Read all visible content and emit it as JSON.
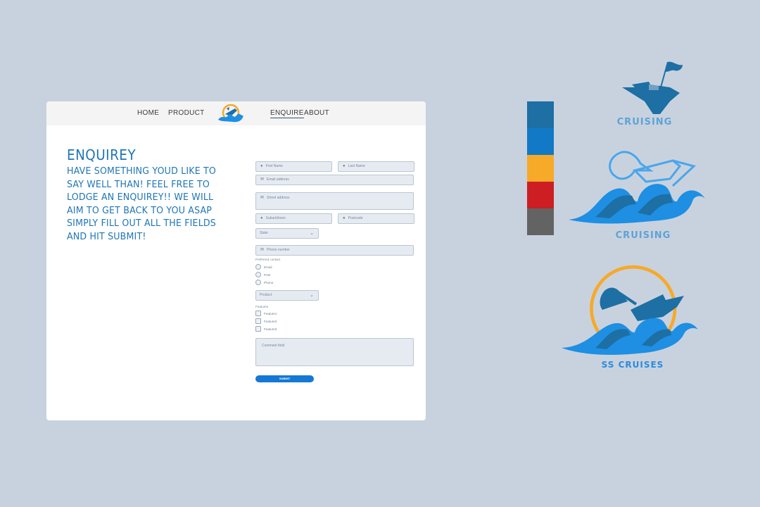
{
  "nav": {
    "home": "HOME",
    "product": "PRODUCT",
    "enquire": "ENQUIRE",
    "about": "ABOUT"
  },
  "hero": {
    "title": "ENQUIREY",
    "text": "HAVE SOMETHING YOUD LIKE TO SAY WELL THAN! FEEL FREE TO LODGE AN ENQUIREY!! WE WILL AIM TO GET BACK TO YOU ASAP SIMPLY FILL OUT ALL THE FIELDS AND HIT SUBMIT!"
  },
  "form": {
    "first_name": "First Name",
    "last_name": "Last Name",
    "email": "Email address",
    "street": "Street address",
    "suburb": "Suburb/town",
    "postcode": "Postcode",
    "state": "State",
    "phone": "Phone number",
    "preferred_contact_label": "Preferred contact",
    "contact_options": [
      "Email",
      "Post",
      "Phone"
    ],
    "product": "Product",
    "features_label": "Features",
    "features": [
      "Feature1",
      "Feature2",
      "Feature3"
    ],
    "comment": "Comment field",
    "submit": "SUBMIT"
  },
  "palette": [
    "#1d6fa4",
    "#1179c6",
    "#f7a928",
    "#cc1e23",
    "#636363"
  ],
  "logos": {
    "caption1": "CRUISING",
    "caption2": "CRUISING",
    "caption3": "SS CRUISES"
  },
  "icons": {
    "user": "user-icon",
    "mail": "mail-icon",
    "phone": "phone-icon",
    "chevron": "chevron-down-icon"
  }
}
